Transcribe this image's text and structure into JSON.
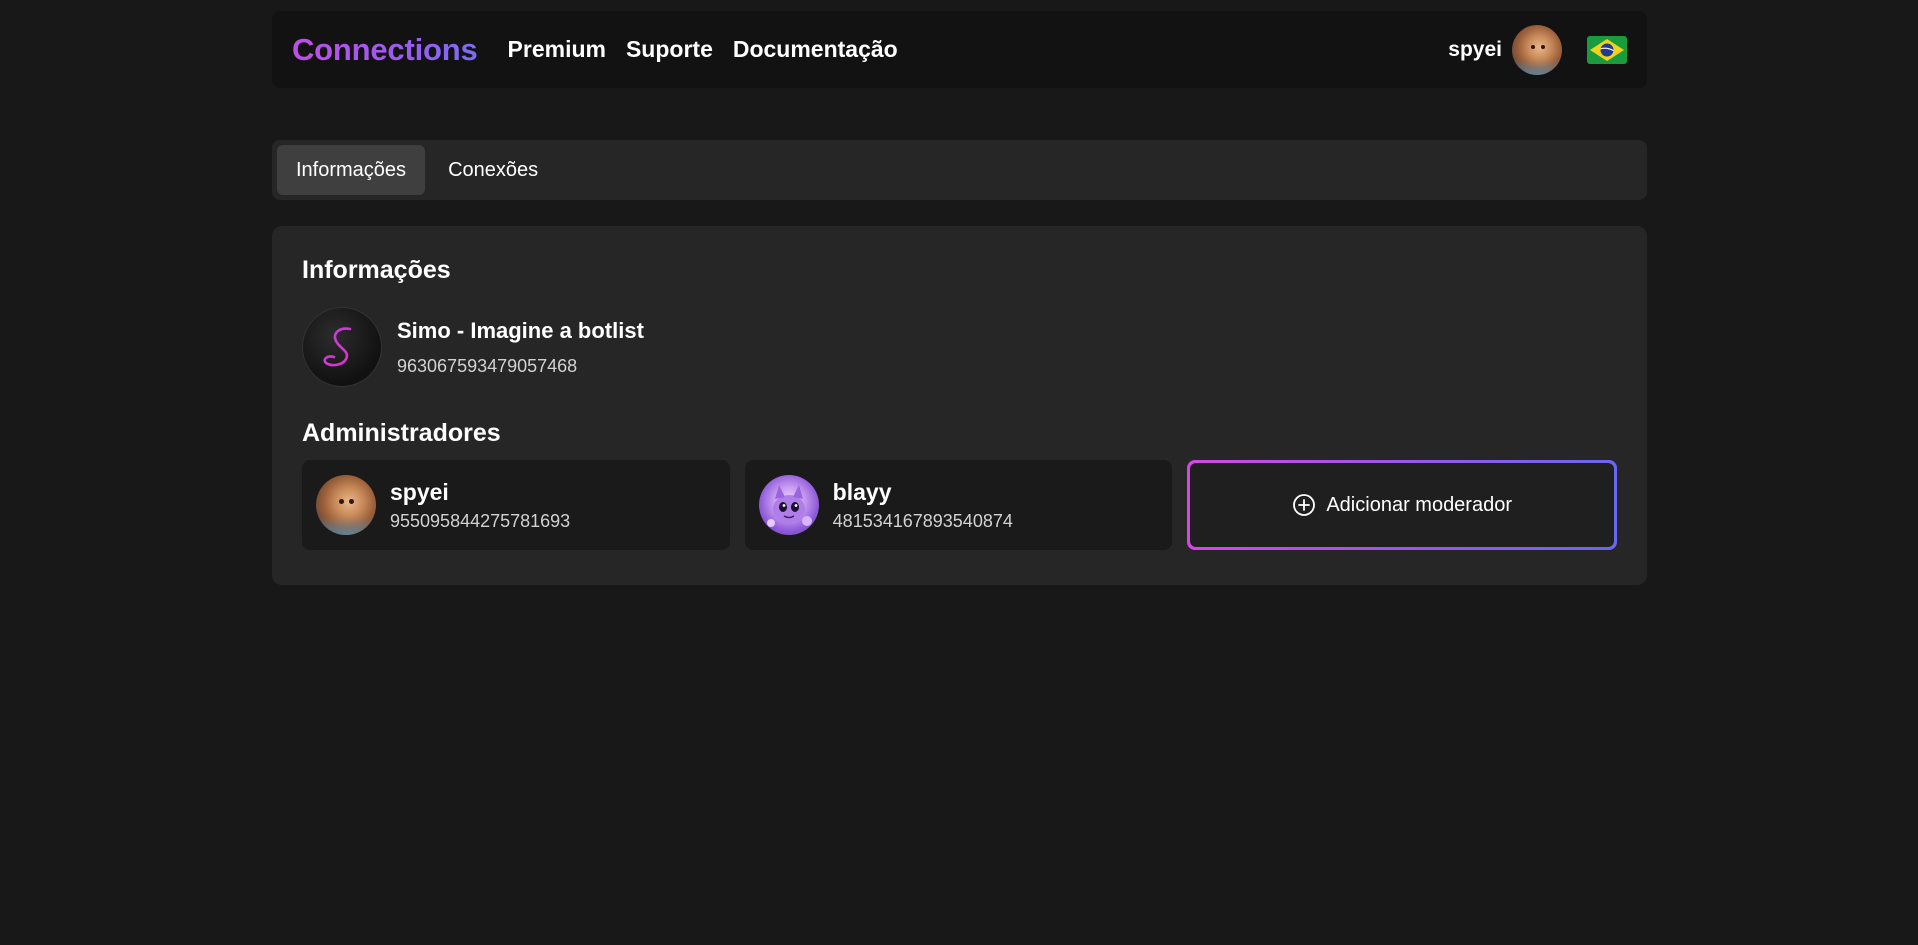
{
  "navbar": {
    "brand": "Connections",
    "links": [
      "Premium",
      "Suporte",
      "Documentação"
    ],
    "username": "spyei",
    "flag_icon": "brazil-flag-icon"
  },
  "tabs": [
    {
      "label": "Informações",
      "active": true
    },
    {
      "label": "Conexões",
      "active": false
    }
  ],
  "info": {
    "title": "Informações",
    "bot": {
      "name": "Simo - Imagine a botlist",
      "id": "963067593479057468"
    }
  },
  "admins": {
    "title": "Administradores",
    "items": [
      {
        "name": "spyei",
        "id": "955095844275781693"
      },
      {
        "name": "blayy",
        "id": "481534167893540874"
      }
    ],
    "add_label": "Adicionar moderador"
  },
  "colors": {
    "background": "#181818",
    "navbar": "#121212",
    "panel": "#262626",
    "accent_start": "#d646e6",
    "accent_end": "#6a66f4"
  }
}
